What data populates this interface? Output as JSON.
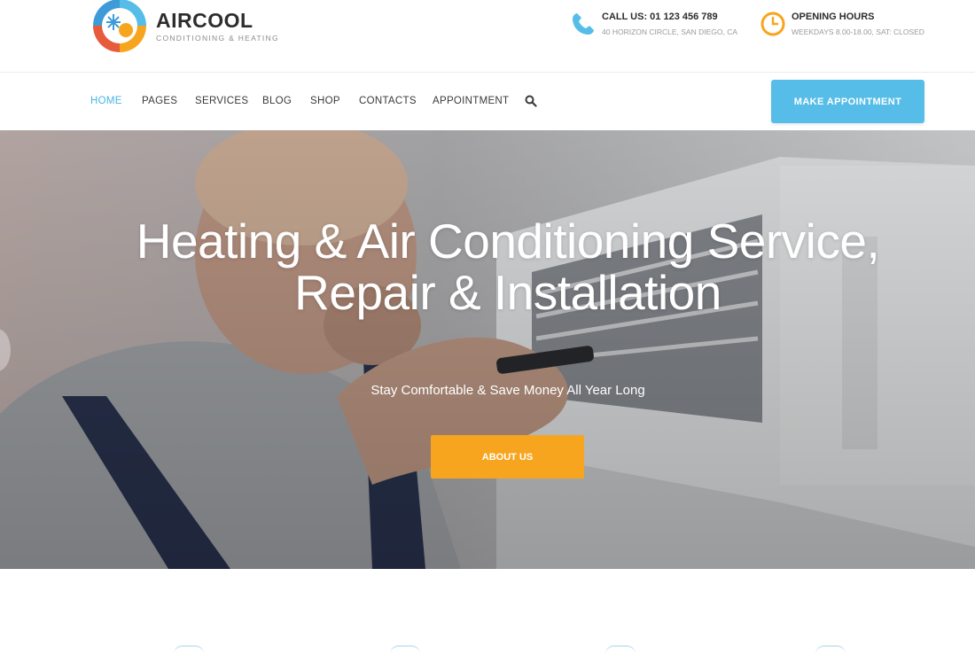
{
  "brand": {
    "name": "AIRCOOL",
    "tagline": "CONDITIONING & HEATING"
  },
  "contact": {
    "call_title": "CALL US: 01 123 456 789",
    "call_address": "40 HORIZON CIRCLE, SAN DIEGO, CA",
    "hours_title": "OPENING HOURS",
    "hours_text": "WEEKDAYS 8.00-18.00, SAT: CLOSED"
  },
  "nav": {
    "items": [
      "HOME",
      "PAGES",
      "SERVICES",
      "BLOG",
      "SHOP",
      "CONTACTS",
      "APPOINTMENT"
    ],
    "active": "HOME",
    "cta_label": "MAKE APPOINTMENT"
  },
  "hero": {
    "title_line1": "Heating & Air Conditioning Service,",
    "title_line2": "Repair & Installation",
    "subtitle": "Stay Comfortable & Save Money All Year Long",
    "button_label": "ABOUT US"
  },
  "colors": {
    "accent_blue": "#56bde8",
    "accent_orange": "#f7a51e",
    "active_nav": "#47b4e4",
    "text_dark": "#2d2d2d"
  },
  "icons": [
    "aircool-logo-icon",
    "phone-icon",
    "clock-icon",
    "search-icon"
  ]
}
